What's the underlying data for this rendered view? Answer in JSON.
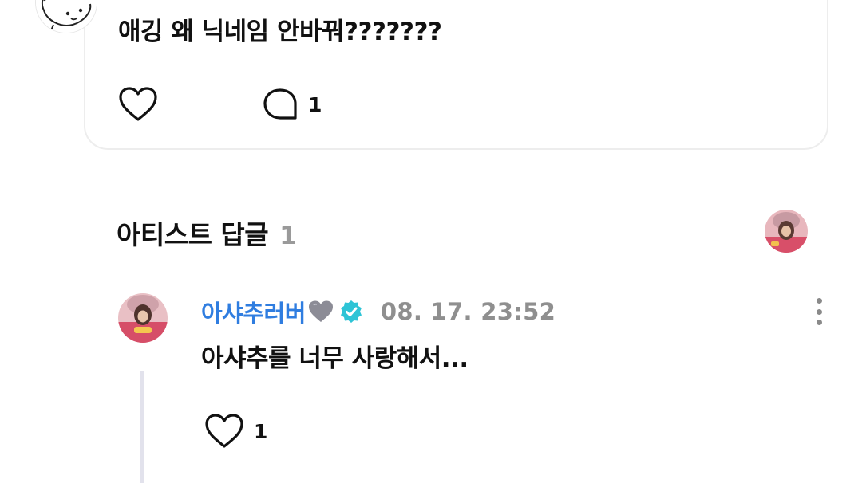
{
  "post": {
    "text": "애깅 왜 닉네임 안바꿔???????",
    "like_count": "",
    "comment_count": "1"
  },
  "artist_replies": {
    "title": "아티스트 답글",
    "count": "1"
  },
  "reply": {
    "author": "아샤추러버",
    "author_emoji": "🩶",
    "date": "08. 17. 23:52",
    "text": "아샤추를 너무 사랑해서...",
    "like_count": "1"
  },
  "icons": {
    "like": "heart-outline-icon",
    "comment": "speech-bubble-icon",
    "verified": "verified-badge-icon",
    "more": "more-vertical-icon"
  },
  "colors": {
    "accent": "#2f7de0",
    "verified": "#2ec4d6",
    "muted": "#8f8f8f"
  }
}
